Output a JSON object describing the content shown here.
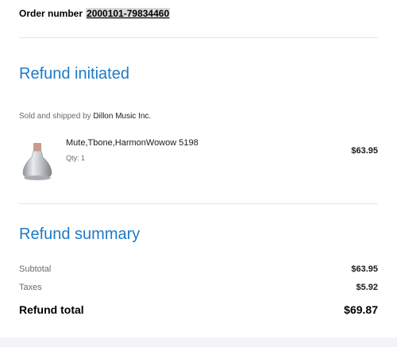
{
  "order": {
    "label": "Order number",
    "number": "2000101-79834460"
  },
  "refund_status": {
    "title": "Refund initiated",
    "seller_prefix": "Sold and shipped by",
    "seller_name": "Dillon Music Inc."
  },
  "item": {
    "name": "Mute,Tbone,HarmonWowow 5198",
    "qty": "Qty: 1",
    "price": "$63.95",
    "image_icon": "trombone-mute-product-image"
  },
  "summary": {
    "title": "Refund summary",
    "subtotal_label": "Subtotal",
    "subtotal_value": "$63.95",
    "taxes_label": "Taxes",
    "taxes_value": "$5.92",
    "total_label": "Refund total",
    "total_value": "$69.87"
  },
  "colors": {
    "accent": "#1e7ac7",
    "divider": "#e6e6e6",
    "footer": "#f3f4f8"
  }
}
